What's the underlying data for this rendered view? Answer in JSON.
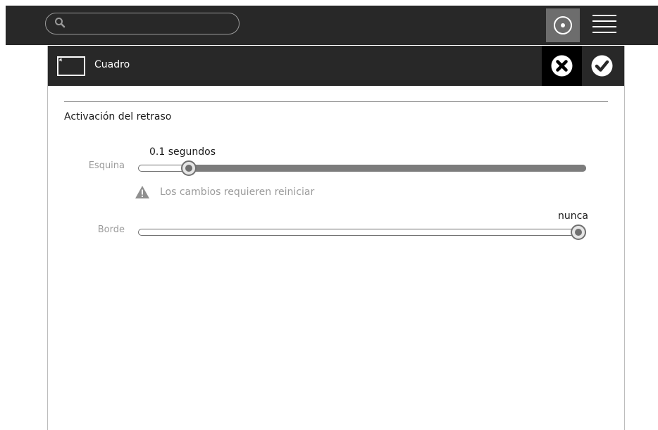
{
  "toolbar": {
    "search": {
      "placeholder": "",
      "value": ""
    },
    "icons": [
      "search-icon",
      "screen-view-icon",
      "menu-icon"
    ]
  },
  "panel": {
    "title": "Cuadro",
    "icon": "frame-icon",
    "cancel_icon": "cancel-icon",
    "accept_icon": "accept-icon"
  },
  "section": {
    "title": "Activación del retraso"
  },
  "corner": {
    "label": "Esquina",
    "value_label": "0.1 segundos",
    "level": 0.1
  },
  "warning": {
    "icon": "warning-icon",
    "text": "Los cambios requieren reiniciar"
  },
  "edge": {
    "label": "Borde",
    "value_label": "nunca",
    "level": 1.0
  },
  "colors": {
    "toolbar_bg": "#282828",
    "active_button_bg": "#6d6d6d",
    "muted_text": "#9b9b9b",
    "slider_fill": "#7c7c7c"
  }
}
